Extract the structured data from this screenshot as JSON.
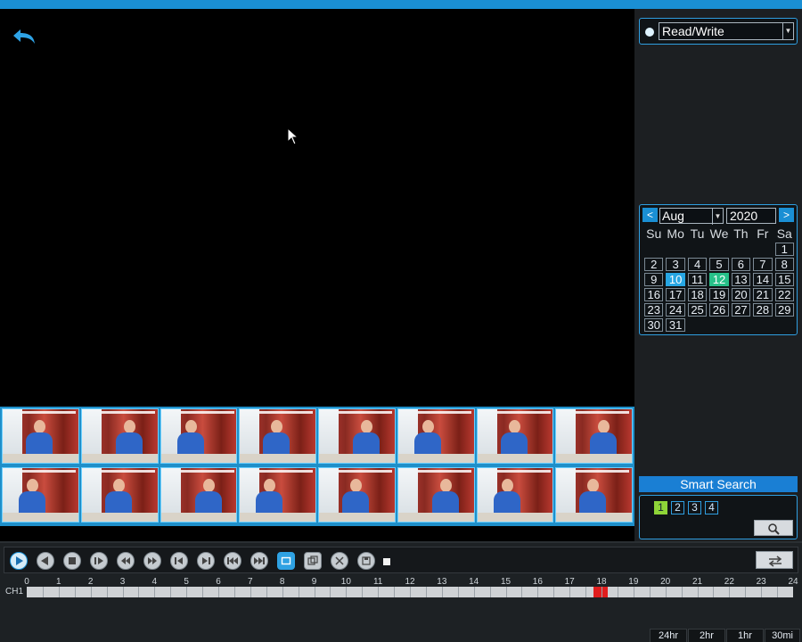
{
  "record_mode": {
    "label": "Read/Write"
  },
  "calendar": {
    "month": "Aug",
    "year": "2020",
    "prev": "<",
    "next": ">",
    "weekdays": [
      "Su",
      "Mo",
      "Tu",
      "We",
      "Th",
      "Fr",
      "Sa"
    ],
    "leading_blanks": 6,
    "days": [
      "1",
      "2",
      "3",
      "4",
      "5",
      "6",
      "7",
      "8",
      "9",
      "10",
      "11",
      "12",
      "13",
      "14",
      "15",
      "16",
      "17",
      "18",
      "19",
      "20",
      "21",
      "22",
      "23",
      "24",
      "25",
      "26",
      "27",
      "28",
      "29",
      "30",
      "31"
    ],
    "recorded_days": [
      "10"
    ],
    "selected_day": "12"
  },
  "smart_search": {
    "label": "Smart Search"
  },
  "channels": [
    "1",
    "2",
    "3",
    "4"
  ],
  "active_channel": "1",
  "timeline": {
    "channel_label": "CH1",
    "hours": [
      "0",
      "1",
      "2",
      "3",
      "4",
      "5",
      "6",
      "7",
      "8",
      "9",
      "10",
      "11",
      "12",
      "13",
      "14",
      "15",
      "16",
      "17",
      "18",
      "19",
      "20",
      "21",
      "22",
      "23",
      "24"
    ],
    "recording_blocks": [
      [
        17.75,
        18.0
      ],
      [
        18.02,
        18.2
      ]
    ]
  },
  "zoom_options": [
    "24hr",
    "2hr",
    "1hr",
    "30mi"
  ],
  "colors": {
    "accent": "#1a8fd4",
    "recorded": "#27a6e3",
    "selected": "#27c089",
    "record_bar": "#e01d1d"
  },
  "thumbnails_count": 16
}
